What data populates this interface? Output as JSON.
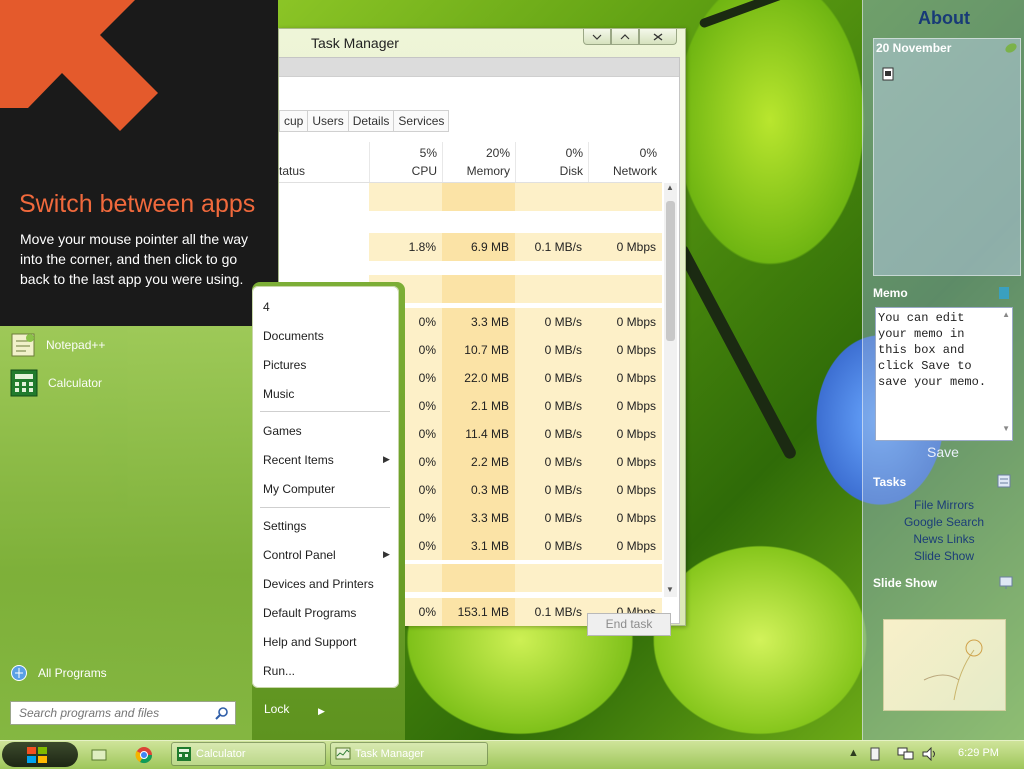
{
  "tip": {
    "title": "Switch between apps",
    "body": "Move your mouse pointer all the way into the corner, and then click to go back to the last app you were using.",
    "accent_color": "#f0693c"
  },
  "task_manager": {
    "title": "Task Manager",
    "tabs": [
      "cup",
      "Users",
      "Details",
      "Services"
    ],
    "status_header": "tatus",
    "columns": [
      {
        "name": "CPU",
        "pct": "5%"
      },
      {
        "name": "Memory",
        "pct": "20%"
      },
      {
        "name": "Disk",
        "pct": "0%"
      },
      {
        "name": "Network",
        "pct": "0%"
      }
    ],
    "rows": [
      {
        "cpu": "",
        "mem": "",
        "disk": "",
        "net": ""
      },
      {
        "cpu": "1.8%",
        "mem": "6.9 MB",
        "disk": "0.1 MB/s",
        "net": "0 Mbps"
      },
      {
        "cpu": "",
        "mem": "",
        "disk": "",
        "net": ""
      },
      {
        "cpu": "0%",
        "mem": "3.3 MB",
        "disk": "0 MB/s",
        "net": "0 Mbps"
      },
      {
        "cpu": "0%",
        "mem": "10.7 MB",
        "disk": "0 MB/s",
        "net": "0 Mbps"
      },
      {
        "cpu": "0%",
        "mem": "22.0 MB",
        "disk": "0 MB/s",
        "net": "0 Mbps"
      },
      {
        "cpu": "0%",
        "mem": "2.1 MB",
        "disk": "0 MB/s",
        "net": "0 Mbps"
      },
      {
        "cpu": "0%",
        "mem": "11.4 MB",
        "disk": "0 MB/s",
        "net": "0 Mbps"
      },
      {
        "cpu": "0%",
        "mem": "2.2 MB",
        "disk": "0 MB/s",
        "net": "0 Mbps"
      },
      {
        "cpu": "0%",
        "mem": "0.3 MB",
        "disk": "0 MB/s",
        "net": "0 Mbps"
      },
      {
        "cpu": "0%",
        "mem": "3.3 MB",
        "disk": "0 MB/s",
        "net": "0 Mbps"
      },
      {
        "cpu": "0%",
        "mem": "3.1 MB",
        "disk": "0 MB/s",
        "net": "0 Mbps"
      },
      {
        "cpu": "",
        "mem": "",
        "disk": "",
        "net": ""
      },
      {
        "cpu": "0%",
        "mem": "153.1 MB",
        "disk": "0.1 MB/s",
        "net": "0 Mbps"
      }
    ],
    "end_task_label": "End task"
  },
  "start_menu": {
    "pinned": [
      {
        "label": "Notepad++",
        "icon": "notepad-plus-plus-icon"
      },
      {
        "label": "Calculator",
        "icon": "calculator-icon"
      }
    ],
    "all_programs_label": "All Programs",
    "search_placeholder": "Search programs and files",
    "places": [
      {
        "label": "4",
        "submenu": false
      },
      {
        "label": "Documents",
        "submenu": false
      },
      {
        "label": "Pictures",
        "submenu": false
      },
      {
        "label": "Music",
        "submenu": false
      },
      {
        "label": "Games",
        "submenu": false
      },
      {
        "label": "Recent Items",
        "submenu": true
      },
      {
        "label": "My Computer",
        "submenu": false
      },
      {
        "label": "Settings",
        "submenu": false
      },
      {
        "label": "Control Panel",
        "submenu": true
      },
      {
        "label": "Devices and Printers",
        "submenu": false
      },
      {
        "label": "Default Programs",
        "submenu": false
      },
      {
        "label": "Help and Support",
        "submenu": false
      },
      {
        "label": "Run...",
        "submenu": false
      }
    ],
    "lock_label": "Lock"
  },
  "sidebar": {
    "about_title": "About",
    "calendar_date": "20 November",
    "memo_title": "Memo",
    "memo_text": "You can edit your memo in this box and click Save to save your memo.",
    "save_label": "Save",
    "tasks_title": "Tasks",
    "task_links": [
      "File Mirrors",
      "Google Search",
      "News Links",
      "Slide Show"
    ],
    "slideshow_title": "Slide Show"
  },
  "taskbar": {
    "buttons": [
      {
        "label": "Calculator",
        "icon": "calculator-icon"
      },
      {
        "label": "Task Manager",
        "icon": "task-manager-icon"
      }
    ],
    "clock": "6:29 PM"
  }
}
